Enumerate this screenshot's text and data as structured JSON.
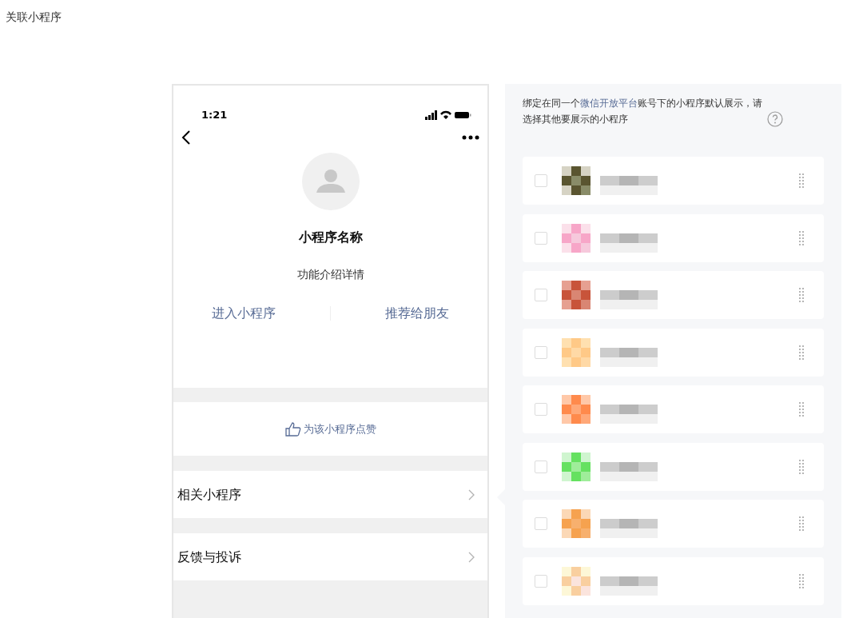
{
  "page_title": "关联小程序",
  "phone": {
    "time": "1:21",
    "app_name": "小程序名称",
    "description": "功能介绍详情",
    "actions": [
      "进入小程序",
      "推荐给朋友"
    ],
    "like_label": "为该小程序点赞",
    "menu_rows": [
      "相关小程序",
      "反馈与投诉"
    ]
  },
  "panel": {
    "note_start": "绑定在同一个",
    "note_link": "微信开放平台",
    "note_end": "账号下的小程序默认展示，请选择其他要展示的小程序",
    "items": [
      {
        "checked": false
      },
      {
        "checked": false
      },
      {
        "checked": false
      },
      {
        "checked": false
      },
      {
        "checked": false
      },
      {
        "checked": false
      },
      {
        "checked": false
      },
      {
        "checked": false
      }
    ]
  }
}
